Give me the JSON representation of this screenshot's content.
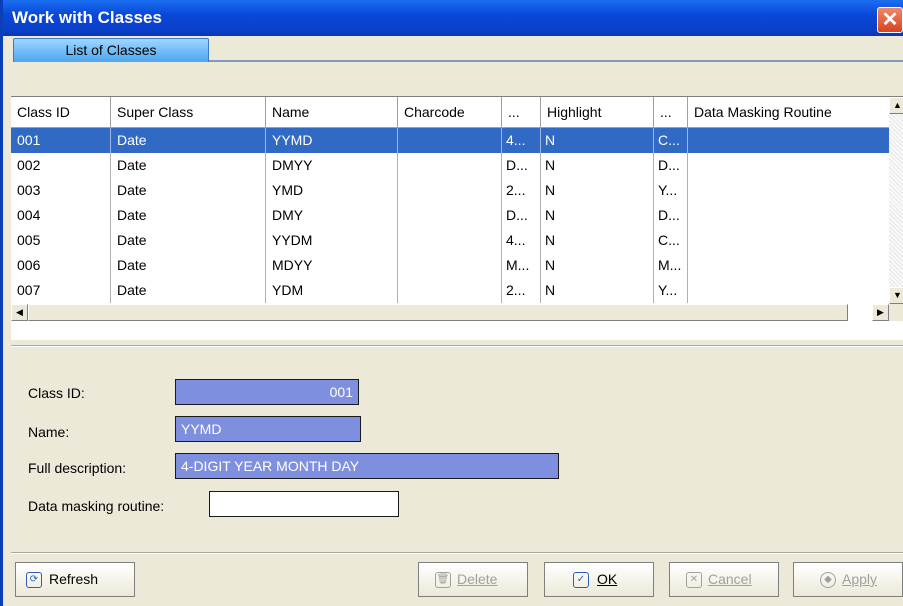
{
  "window": {
    "title": "Work with Classes",
    "close_glyph": "✕"
  },
  "tabs": [
    {
      "label": "List of Classes",
      "active": true
    }
  ],
  "grid": {
    "columns": [
      "Class ID",
      "Super Class",
      "Name",
      "Charcode",
      "...",
      "Highlight",
      "...",
      "Data Masking Routine"
    ],
    "rows": [
      [
        "001",
        "Date",
        "YYMD",
        "",
        "4...",
        "N",
        "C...",
        ""
      ],
      [
        "002",
        "Date",
        "DMYY",
        "",
        "D...",
        "N",
        "D...",
        ""
      ],
      [
        "003",
        "Date",
        "YMD",
        "",
        "2...",
        "N",
        "Y...",
        ""
      ],
      [
        "004",
        "Date",
        "DMY",
        "",
        "D...",
        "N",
        "D...",
        ""
      ],
      [
        "005",
        "Date",
        "YYDM",
        "",
        "4...",
        "N",
        "C...",
        ""
      ],
      [
        "006",
        "Date",
        "MDYY",
        "",
        "M...",
        "N",
        "M...",
        ""
      ],
      [
        "007",
        "Date",
        "YDM",
        "",
        "2...",
        "N",
        "Y...",
        ""
      ]
    ],
    "selected_row": 0
  },
  "form": {
    "class_id_label": "Class ID:",
    "class_id_value": "001",
    "name_label": "Name:",
    "name_value": "YYMD",
    "full_description_label": "Full description:",
    "full_description_value": "4-DIGIT YEAR MONTH DAY",
    "data_masking_label": "Data masking routine:",
    "data_masking_value": ""
  },
  "buttons": {
    "refresh": "Refresh",
    "delete": "Delete",
    "ok": "OK",
    "cancel": "Cancel",
    "apply": "Apply"
  },
  "icons": {
    "close": "close-icon",
    "refresh": "refresh-icon",
    "delete": "trash-icon",
    "ok": "checkmark-icon",
    "cancel": "x-icon",
    "apply": "apply-icon"
  },
  "colors": {
    "titlebar": "#0a48d8",
    "selection": "#316ac5",
    "field_selected": "#7f8fe0",
    "tab_active": "#4aa6f0"
  }
}
